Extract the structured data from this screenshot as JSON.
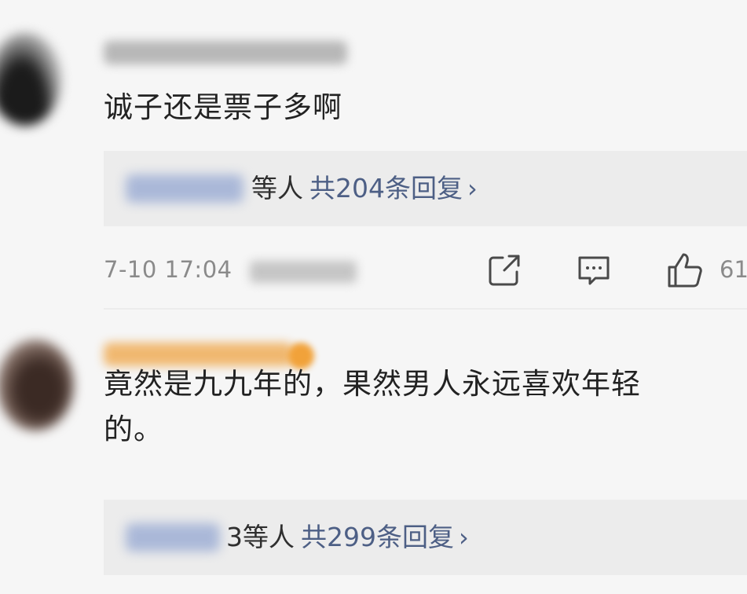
{
  "comments": [
    {
      "text_lines": [
        "诚子还是票子多啊"
      ],
      "replies": {
        "suffix": "等人",
        "summary": "共204条回复",
        "arrow": "›"
      },
      "meta": {
        "time": "7-10 17:04",
        "likes": "61"
      }
    },
    {
      "text_lines": [
        "竟然是九九年的，果然男人永远喜欢年轻",
        "的。"
      ],
      "replies": {
        "suffix": "3等人",
        "summary": "共299条回复",
        "arrow": "›"
      }
    }
  ],
  "icons": {
    "share": "share-icon",
    "comment": "comment-icon",
    "like": "thumbs-up-icon"
  },
  "colors": {
    "link": "#4d5f85",
    "muted": "#8a8a8a",
    "reply_bg": "#ececec"
  }
}
